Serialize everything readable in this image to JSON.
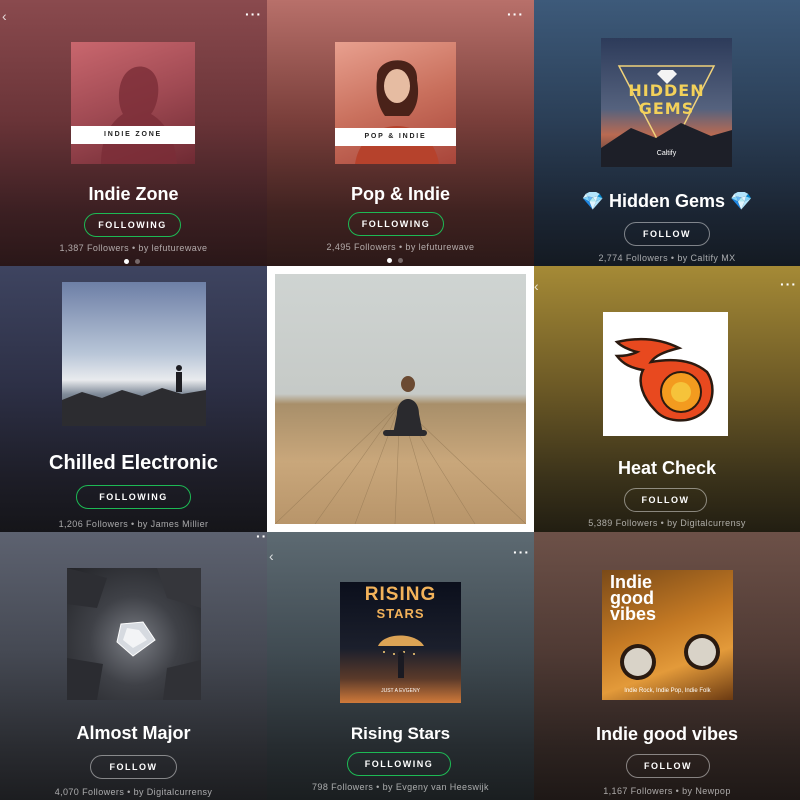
{
  "playlists": [
    {
      "title": "Indie Zone",
      "cover_label": "INDIE ZONE",
      "button": "FOLLOWING",
      "meta": "1,387 Followers • by lefuturewave"
    },
    {
      "title": "Pop & Indie",
      "cover_label": "POP & INDIE",
      "button": "FOLLOWING",
      "meta": "2,495 Followers • by lefuturewave"
    },
    {
      "title": "💎 Hidden Gems 💎",
      "cover_text": "HIDDEN GEMS",
      "cover_brand": "Caltify",
      "button": "FOLLOW",
      "meta": "2,774 Followers • by Caltify MX"
    },
    {
      "title": "Chilled Electronic",
      "button": "FOLLOWING",
      "meta": "1,206 Followers • by James Millier"
    },
    {
      "title": "",
      "button": "",
      "meta": ""
    },
    {
      "title": "Heat Check",
      "button": "FOLLOW",
      "meta": "5,389 Followers • by Digitalcurrensy"
    },
    {
      "title": "Almost Major",
      "button": "FOLLOW",
      "meta": "4,070 Followers • by Digitalcurrensy"
    },
    {
      "title": "Rising Stars",
      "cover_text_1": "RISING",
      "cover_text_2": "STARS",
      "cover_small": "JUST A EVGENY",
      "button": "FOLLOWING",
      "meta": "798 Followers • by Evgeny van Heeswijk"
    },
    {
      "title": "Indie good vibes",
      "cover_text": "Indie good vibes",
      "cover_small": "Indie Rock, Indie Pop, Indie Folk",
      "button": "FOLLOW",
      "meta": "1,167 Followers • by Newpop"
    }
  ],
  "more_label": "···",
  "back_label": "‹",
  "colors": {
    "following_border": "#1db954",
    "follow_border": "rgba(255,255,255,0.45)"
  }
}
